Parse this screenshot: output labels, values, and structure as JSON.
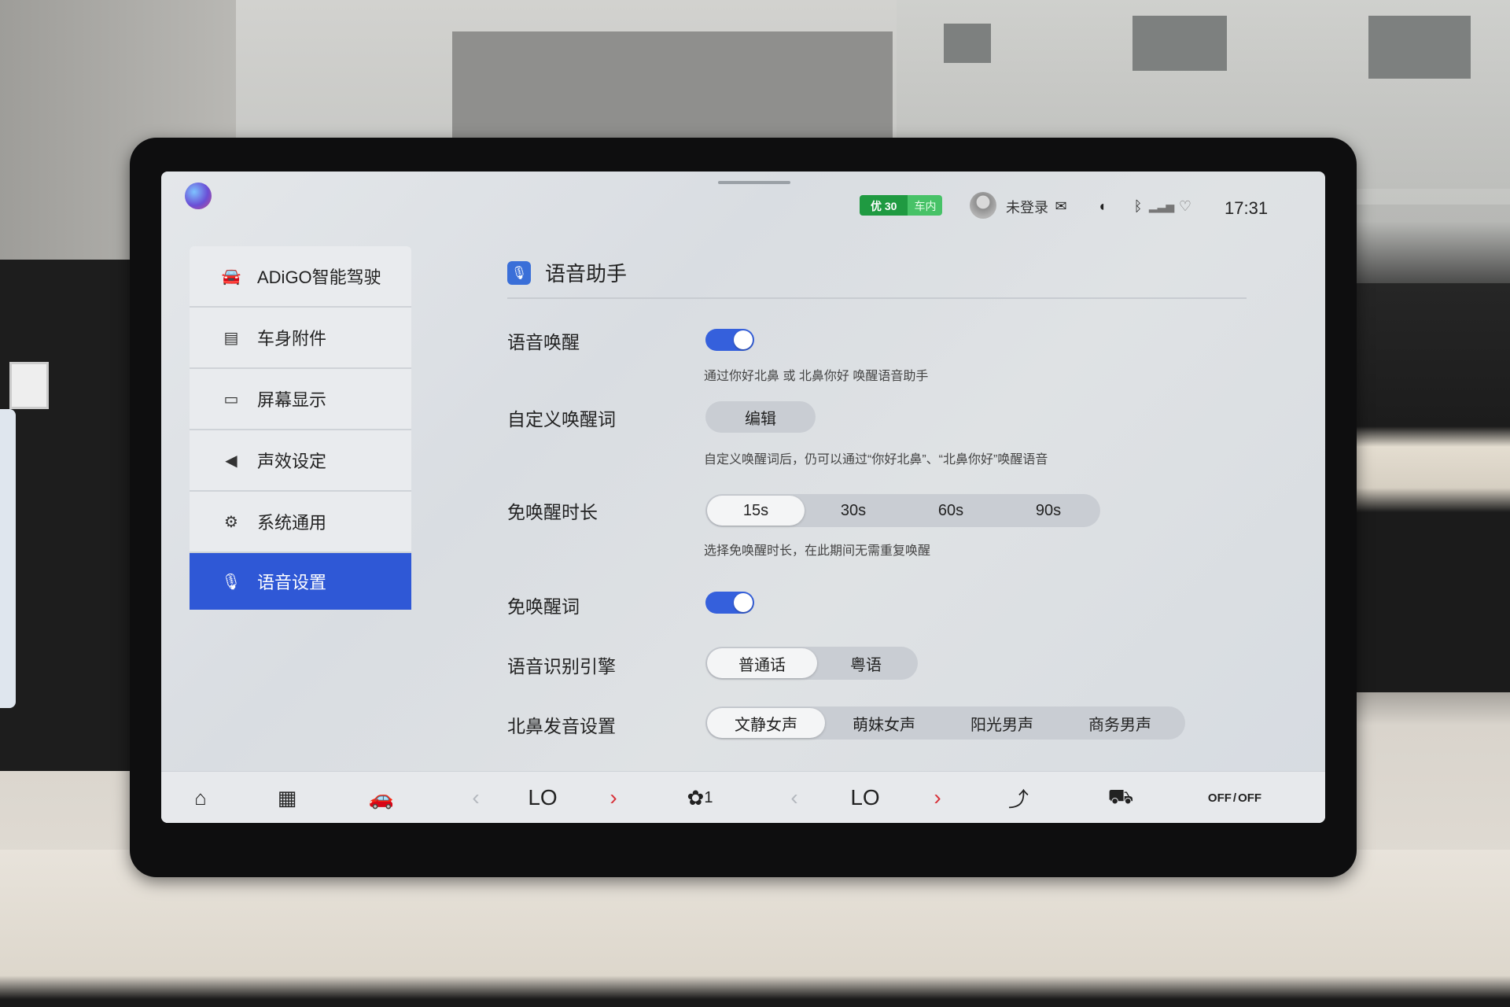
{
  "status_bar": {
    "badge_level": "优 30",
    "badge_location": "车内",
    "login_status": "未登录",
    "time": "17:31",
    "icons": [
      "mail-icon",
      "volume-icon",
      "bluetooth-icon",
      "signal-icon",
      "wifi-icon"
    ]
  },
  "sidebar": {
    "items": [
      {
        "label": "ADiGO智能驾驶",
        "icon": "steering-car-icon"
      },
      {
        "label": "车身附件",
        "icon": "car-body-icon"
      },
      {
        "label": "屏幕显示",
        "icon": "monitor-icon"
      },
      {
        "label": "声效设定",
        "icon": "speaker-icon"
      },
      {
        "label": "系统通用",
        "icon": "gear-icon"
      },
      {
        "label": "语音设置",
        "icon": "mic-icon",
        "active": true
      }
    ]
  },
  "panel": {
    "title": "语音助手",
    "voice_wake": {
      "label": "语音唤醒",
      "enabled": true,
      "hint": "通过你好北鼻 或 北鼻你好 唤醒语音助手"
    },
    "custom_wake": {
      "label": "自定义唤醒词",
      "button": "编辑",
      "hint": "自定义唤醒词后，仍可以通过“你好北鼻”、“北鼻你好”唤醒语音"
    },
    "wake_free_duration": {
      "label": "免唤醒时长",
      "options": [
        "15s",
        "30s",
        "60s",
        "90s"
      ],
      "selected": "15s",
      "hint": "选择免唤醒时长，在此期间无需重复唤醒"
    },
    "wake_free_words": {
      "label": "免唤醒词",
      "enabled": true
    },
    "engine": {
      "label": "语音识别引擎",
      "options": [
        "普通话",
        "粤语"
      ],
      "selected": "普通话"
    },
    "voice_setting": {
      "label": "北鼻发音设置",
      "options": [
        "文静女声",
        "萌妹女声",
        "阳光男声",
        "商务男声"
      ],
      "selected": "文静女声"
    }
  },
  "dock": {
    "left_temp": "LO",
    "right_temp": "LO",
    "fan_level": "1",
    "off_label": "OFF",
    "off_label_2": "OFF",
    "colors": {
      "accent": "#2f58d6",
      "chevron_active": "#d8323a",
      "badge_green": "#1f9a41"
    }
  }
}
